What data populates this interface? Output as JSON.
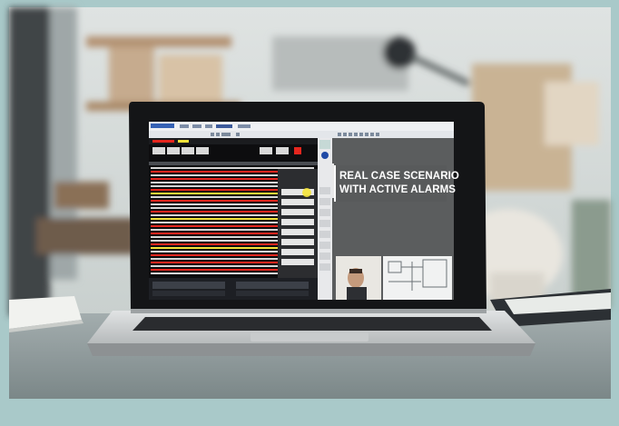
{
  "overlay": {
    "caption_line_1": "REAL CASE SCENARIO",
    "caption_line_2": "WITH ACTIVE ALARMS"
  },
  "screen": {
    "menu_items": [
      "Instruments & Portal",
      "Laws",
      "Views",
      "Edit",
      "Settings",
      "Export"
    ]
  },
  "colors": {
    "frame_teal": "#a9c9c9",
    "wall": "#cfd6d4",
    "shelf_wood": "#b39272",
    "desk": "#8e9b9c",
    "laptop_body": "#d2d5d6",
    "bezel": "#151618",
    "caption_bg": "#585a5b",
    "alarm_red": "#e5261e",
    "alarm_yellow": "#f2e23a",
    "highlight_yellow": "#f5e43a"
  }
}
